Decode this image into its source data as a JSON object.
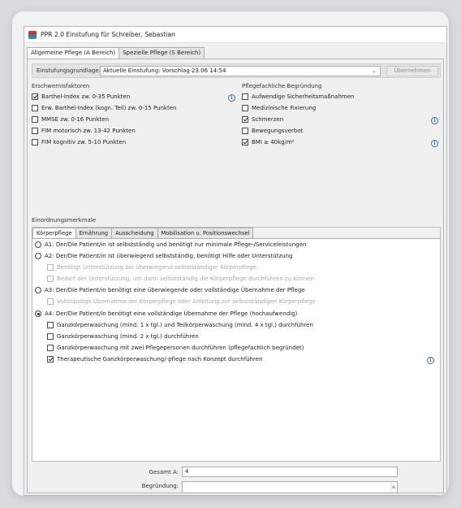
{
  "window": {
    "title": "PPR 2.0 Einstufung für Schreiber, Sebastian"
  },
  "main_tabs": [
    {
      "label": "Allgemeine Pflege (A Bereich)"
    },
    {
      "label": "Spezielle Pflege (S Bereich)"
    }
  ],
  "grundlage": {
    "label": "Einstufungsgrundlage:",
    "value": "Aktuelle Einstufung: Vorschlag 23.06 14:54",
    "button": "Übernehmen"
  },
  "erschwernis": {
    "title": "Erschwernisfaktoren",
    "items": [
      {
        "label": "Barthel-Index zw. 0-35 Punkten",
        "checked": true
      },
      {
        "label": "Erw. Barthel-Index (kogn. Teil) zw. 0-15 Punkten",
        "checked": false
      },
      {
        "label": "MMSE zw. 0-16 Punkten",
        "checked": false
      },
      {
        "label": "FIM motorisch zw. 13-42 Punkten",
        "checked": false
      },
      {
        "label": "FIM kognitiv zw. 5-10 Punkten",
        "checked": false
      }
    ]
  },
  "begruendung_fach": {
    "title": "Pflegefachliche Begründung",
    "items": [
      {
        "label": "Aufwendige Sicherheitsmaßnahmen",
        "checked": false
      },
      {
        "label": "Medizinische Fixierung",
        "checked": false
      },
      {
        "label": "Schmerzen",
        "checked": true
      },
      {
        "label": "Bewegungsverbot",
        "checked": false
      },
      {
        "label": "BMI ≥ 40kg/m²",
        "checked": true
      }
    ]
  },
  "einordnung": {
    "title": "Einordnungsmerkmale",
    "tabs": [
      {
        "label": "Körperpflege"
      },
      {
        "label": "Ernährung"
      },
      {
        "label": "Ausscheidung"
      },
      {
        "label": "Mobilisation u. Positionswechsel"
      }
    ],
    "options": {
      "a1": "A1: Der/Die Patient/in ist selbstständig und benötigt nur minimale Pflege-/Serviceleistungen",
      "a2": "A2: Der/Die Patient/in ist überwiegend selbstständig, benötigt Hilfe oder Unterstützung",
      "a2_sub1": "Benötigt Unterstützung bei überwiegend selbstständiger Körperpflege",
      "a2_sub2": "Bedarf der Unterstützung, um dann selbstständig die Körperpflege durchführen zu können",
      "a3": "A3: Der/Die Patient/in benötigt eine überwiegende oder vollständige Übernahme der Pflege",
      "a3_sub1": "Vollständige Übernahme der Körperpflege oder Anleitung zur selbstständigen Körperpflege",
      "a4": "A4: Der/Die Patient/in benötigt eine vollständige Übernahme der Pflege (hochaufwendig)",
      "a4_sub1": "Ganzkörperwaschung (mind. 1 x tgl.) und Teilkörperwaschung (mind. 4 x tgl.) durchführen",
      "a4_sub2": "Ganzkörperwaschung (mind. 2 x tgl.) durchführen",
      "a4_sub3": "Ganzkörperwaschung mit zwei Pflegepersonen durchführen (pflegefachlich begründet)",
      "a4_sub4": "Therapeutische Ganzkörperwaschung/-pflege nach Konzept durchführen"
    },
    "selected": "A4"
  },
  "footer": {
    "gesamt_label": "Gesamt A:",
    "gesamt_value": "4",
    "begruendung_label": "Begründung:",
    "begruendung_value": ""
  },
  "colors": {
    "accent": "#2f6fb5",
    "disabled_text": "#a8a8a8"
  }
}
